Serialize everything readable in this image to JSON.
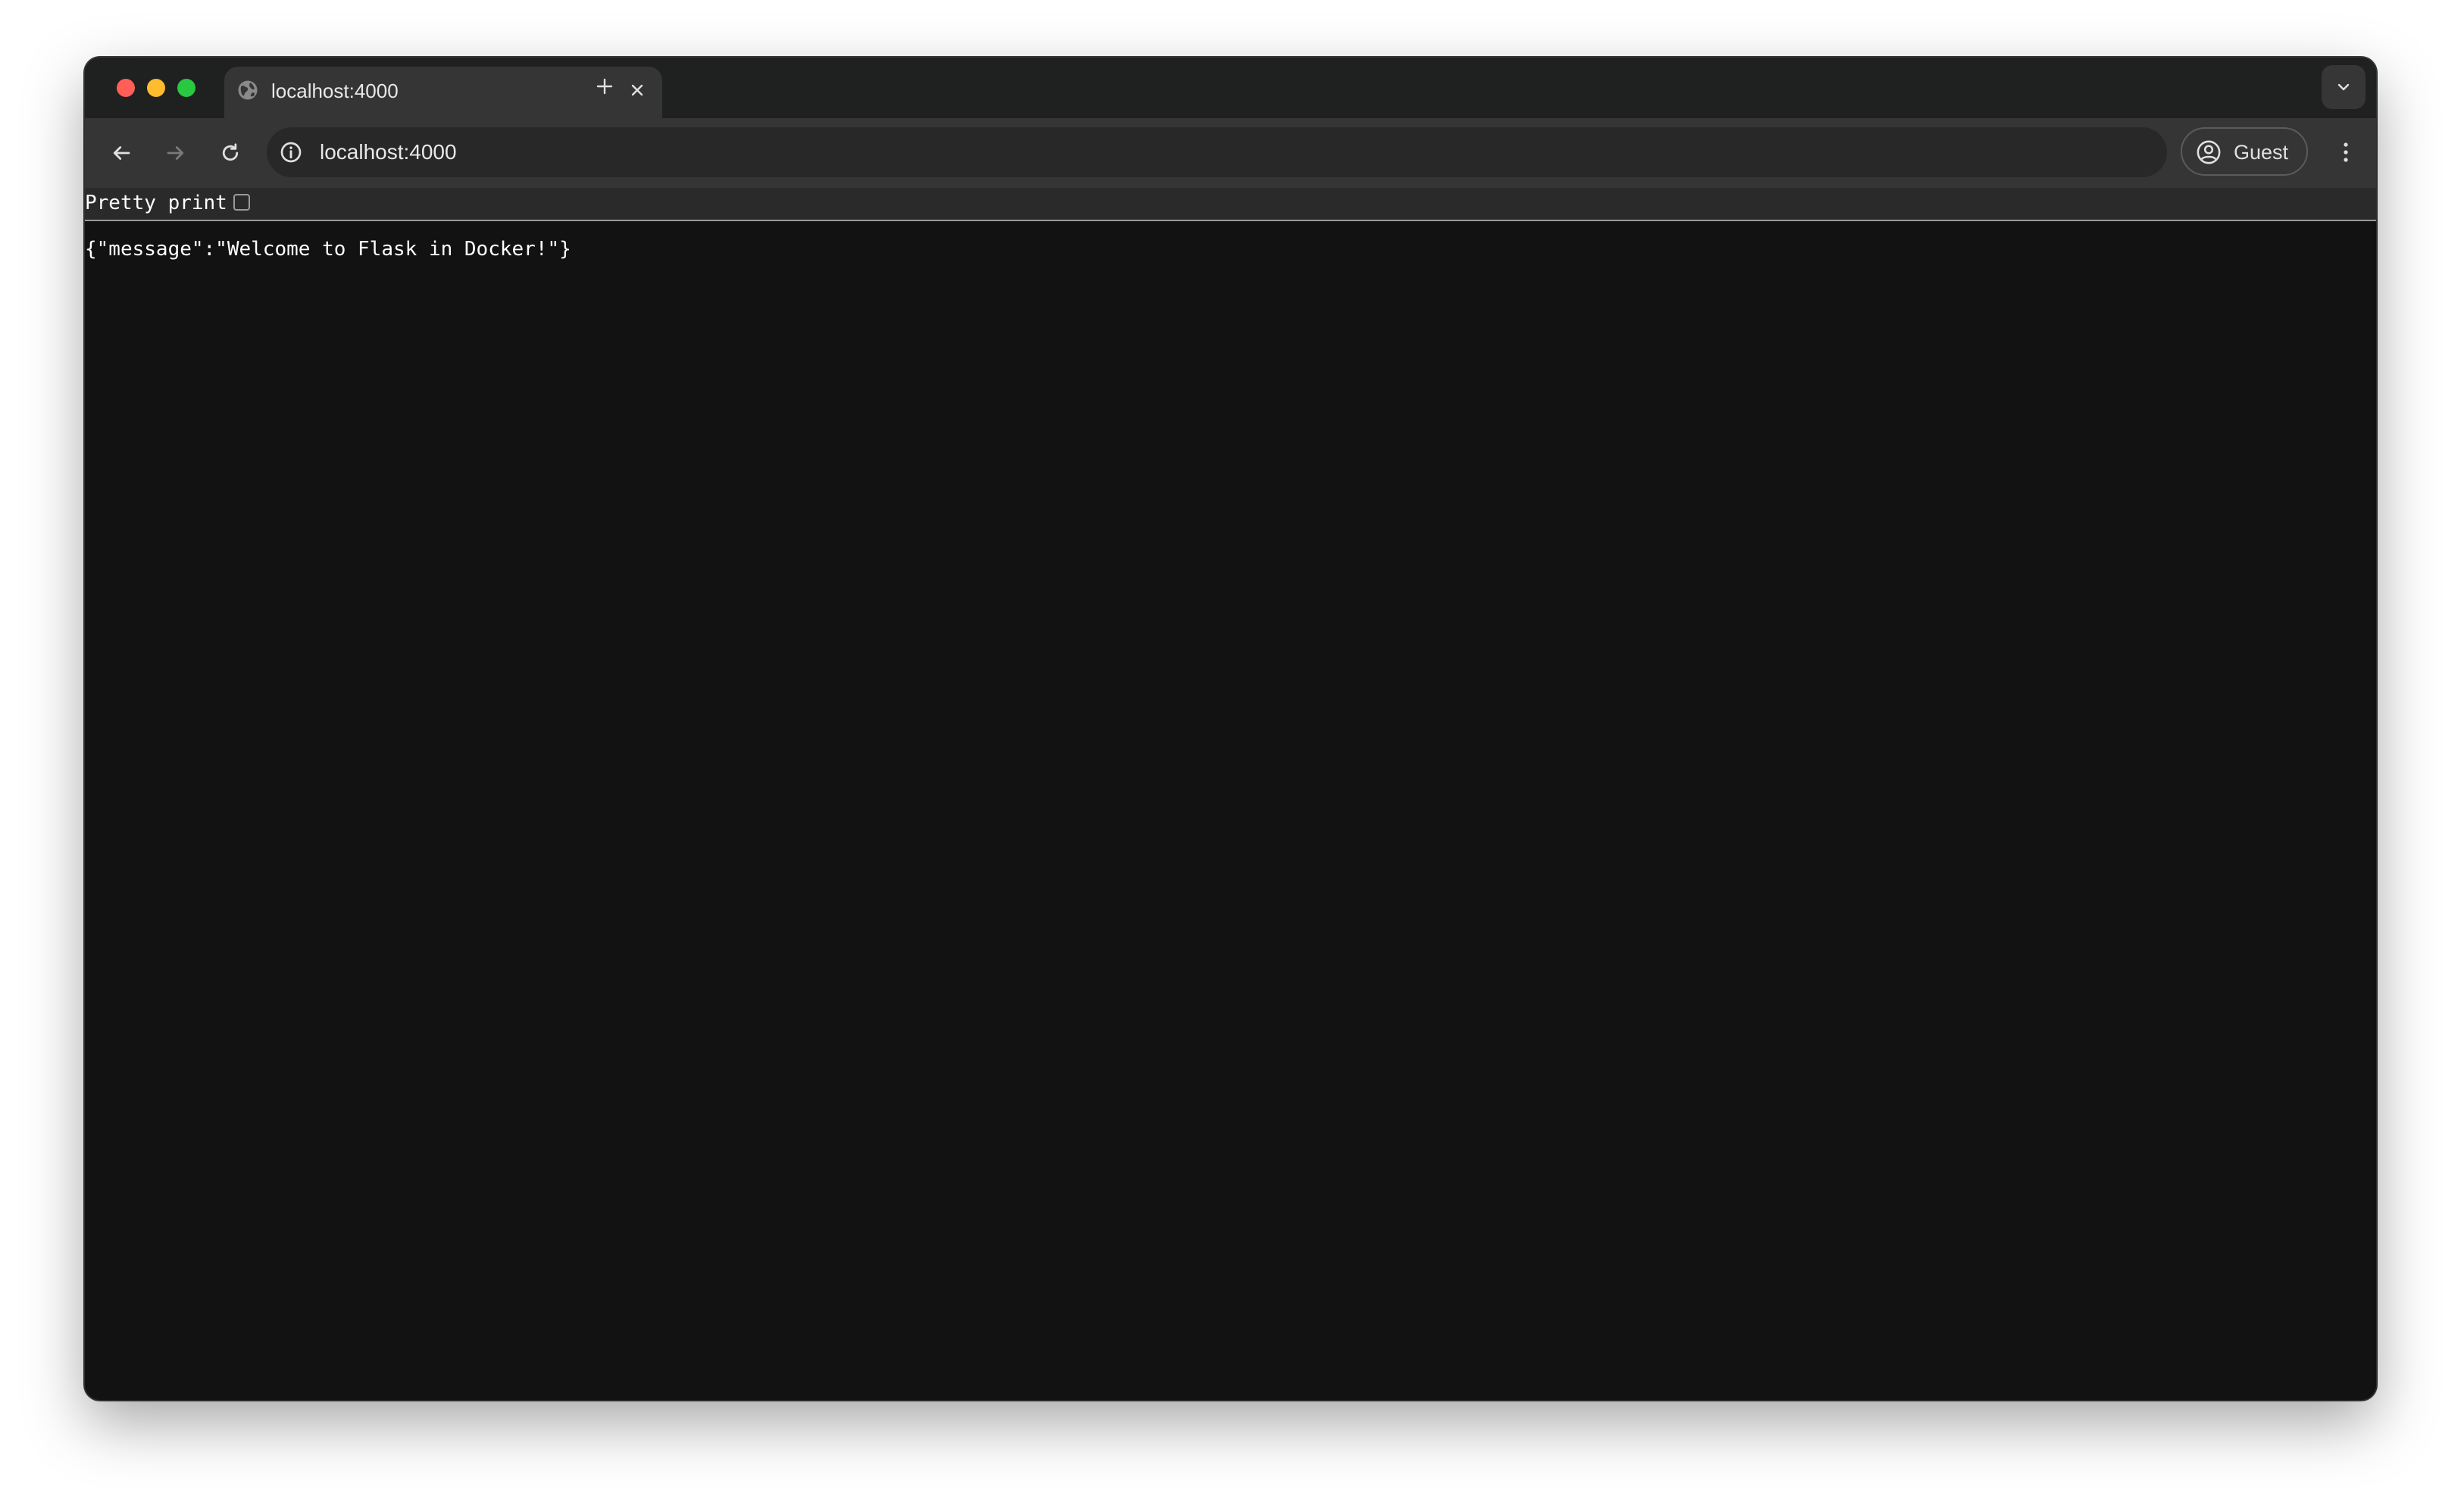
{
  "browser": {
    "tab": {
      "title": "localhost:4000",
      "icon": "globe-icon"
    },
    "address_bar": {
      "value": "localhost:4000",
      "icon": "info-icon"
    },
    "profile": {
      "label": "Guest",
      "icon": "account-circle-icon"
    },
    "controls": {
      "back": "back-arrow-icon",
      "forward": "forward-arrow-icon",
      "reload": "reload-icon",
      "new_tab": "plus-icon",
      "close_tab": "close-icon",
      "tab_search": "chevron-down-icon",
      "menu": "kebab-menu-icon"
    },
    "colors": {
      "close": "#ff5f57",
      "minimize": "#febc2e",
      "maximize": "#28c840"
    }
  },
  "viewer": {
    "pretty_print_label": "Pretty print",
    "pretty_print_checked": false
  },
  "page": {
    "body_text": "{\"message\":\"Welcome to Flask in Docker!\"}"
  }
}
